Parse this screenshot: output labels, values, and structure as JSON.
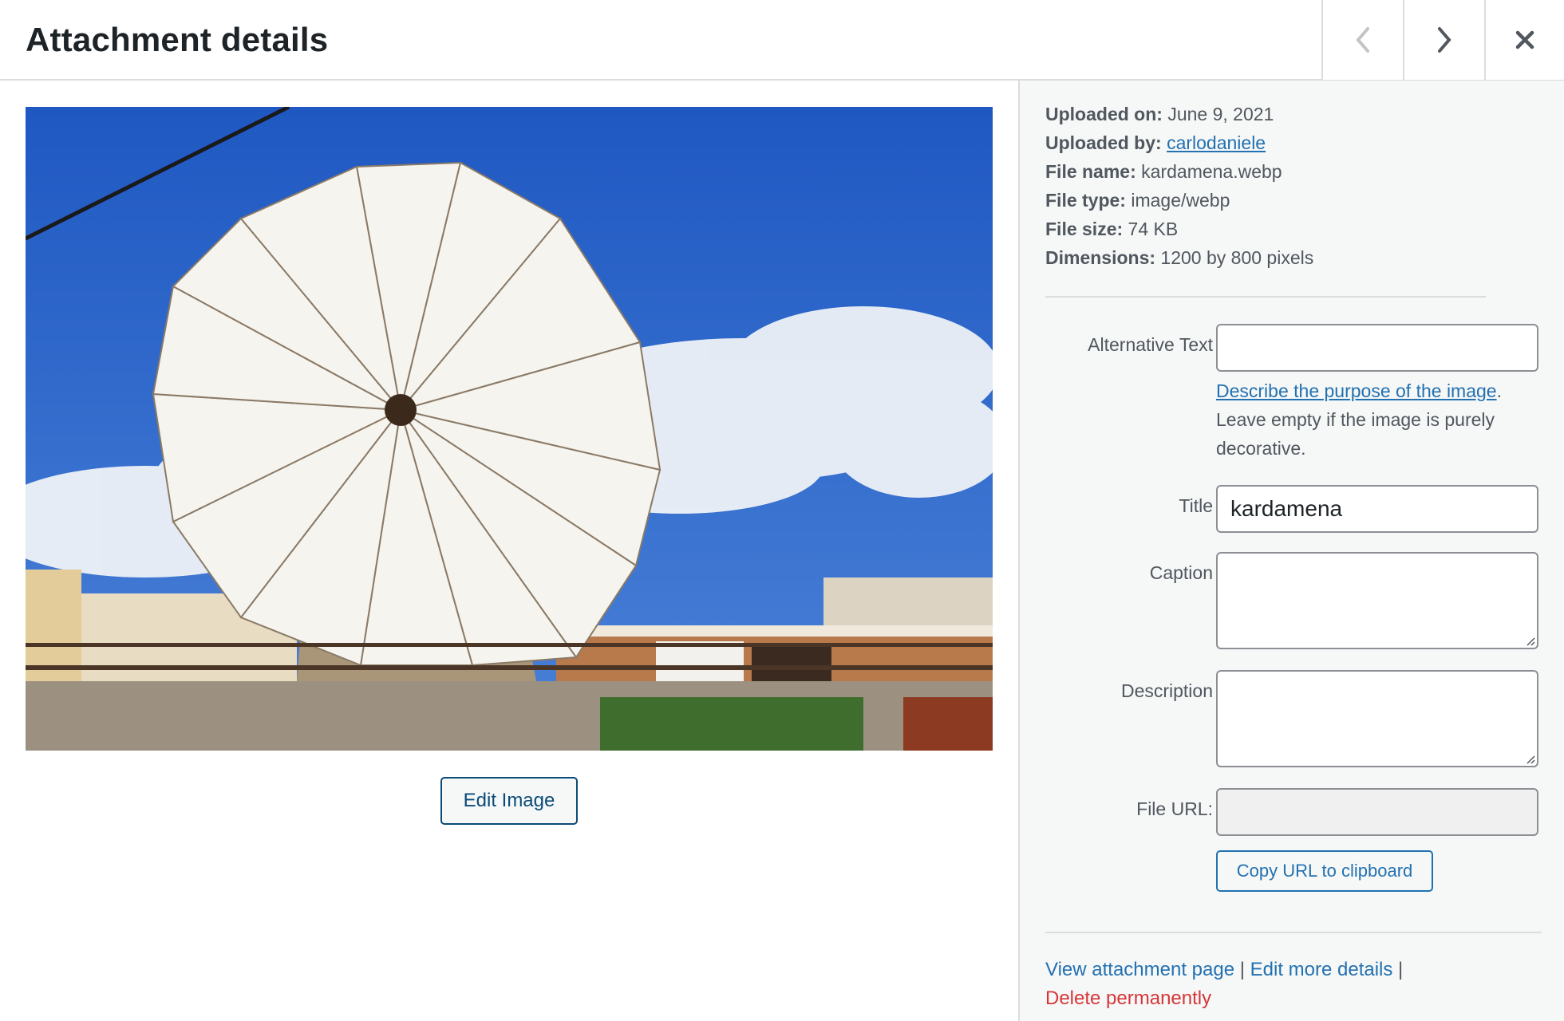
{
  "header": {
    "title": "Attachment details",
    "prev_icon": "chevron-left-icon",
    "next_icon": "chevron-right-icon",
    "close_icon": "close-icon"
  },
  "media": {
    "image_description": "Windmill with white triangular sails against blue sky",
    "edit_image_label": "Edit Image"
  },
  "meta": {
    "uploaded_on_label": "Uploaded on:",
    "uploaded_on": "June 9, 2021",
    "uploaded_by_label": "Uploaded by:",
    "uploaded_by": "carlodaniele",
    "file_name_label": "File name:",
    "file_name": "kardamena.webp",
    "file_type_label": "File type:",
    "file_type": "image/webp",
    "file_size_label": "File size:",
    "file_size": "74 KB",
    "dimensions_label": "Dimensions:",
    "dimensions": "1200 by 800 pixels"
  },
  "form": {
    "alt_text": {
      "label": "Alternative Text",
      "value": ""
    },
    "alt_help_link": "Describe the purpose of the image",
    "alt_help_period": ".",
    "alt_help_text": "Leave empty if the image is purely decorative.",
    "title": {
      "label": "Title",
      "value": "kardamena"
    },
    "caption": {
      "label": "Caption",
      "value": ""
    },
    "description": {
      "label": "Description",
      "value": ""
    },
    "file_url": {
      "label": "File URL:",
      "value": ""
    },
    "copy_url_label": "Copy URL to clipboard"
  },
  "actions": {
    "view_page": "View attachment page",
    "separator": "|",
    "edit_details": "Edit more details",
    "delete": "Delete permanently"
  },
  "colors": {
    "link": "#2271b1",
    "danger": "#d63638",
    "button_border": "#0a4b78",
    "sidebar_bg": "#f6f7f7"
  }
}
